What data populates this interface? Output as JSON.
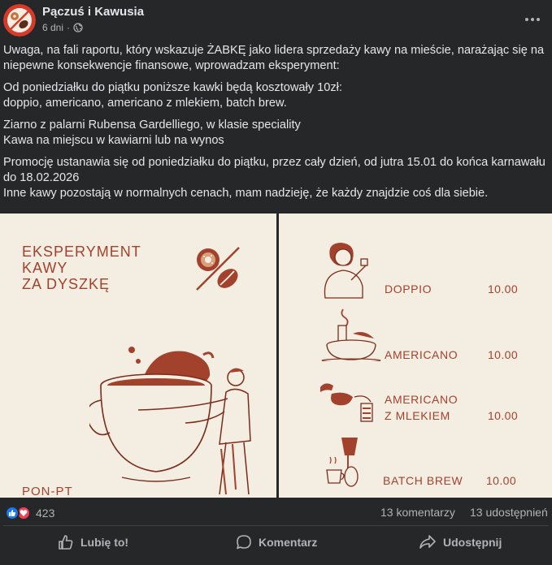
{
  "post": {
    "page_name": "Pączuś i Kawusia",
    "time": "6 dni",
    "paragraphs": [
      "Uwaga, na fali raportu, który wskazuje ŻABKĘ jako lidera sprzedaży kawy na mieście, narażając się na niepewne konsekwencje finansowe, wprowadzam eksperyment:",
      "Od poniedziałku do piątku poniższe kawki będą kosztowały 10zł:\ndoppio, americano, americano z mlekiem, batch brew.",
      "Ziarno z palarni Rubensa Gardelliego, w klasie speciality\nKawa na miejscu w kawiarni lub na wynos",
      "Promocję ustanawia się od poniedziałku do piątku, przez cały dzień, od jutra 15.01 do końca karnawału do 18.02.2026\nInne kawy pozostają  w normalnych cenach, mam nadzieję, że każdy znajdzie coś dla siebie."
    ]
  },
  "poster_left": {
    "title_line1": "EKSPERYMENT",
    "title_line2": "KAWY",
    "title_line3": "ZA DYSZKĘ",
    "footer": "PON-PT"
  },
  "menu": [
    {
      "name_line1": "DOPPIO",
      "name_line2": "",
      "price": "10.00"
    },
    {
      "name_line1": "AMERICANO",
      "name_line2": "",
      "price": "10.00"
    },
    {
      "name_line1": "AMERICANO",
      "name_line2": "Z MLEKIEM",
      "price": "10.00"
    },
    {
      "name_line1": "BATCH BREW",
      "name_line2": "",
      "price": "10.00"
    }
  ],
  "stats": {
    "reactions_count": "423",
    "comments": "13 komentarzy",
    "shares": "13 udostępnień"
  },
  "actions": {
    "like": "Lubię to!",
    "comment": "Komentarz",
    "share": "Udostępnij"
  },
  "colors": {
    "background": "#252728",
    "poster_bg": "#f4ede2",
    "poster_accent": "#a3422c",
    "like_blue": "#1877f2",
    "love_red": "#f33e58"
  },
  "icons": [
    "page-avatar-icon",
    "globe-icon",
    "more-icon",
    "like-reaction-icon",
    "love-reaction-icon",
    "thumbs-up-icon",
    "comment-icon",
    "share-icon"
  ]
}
